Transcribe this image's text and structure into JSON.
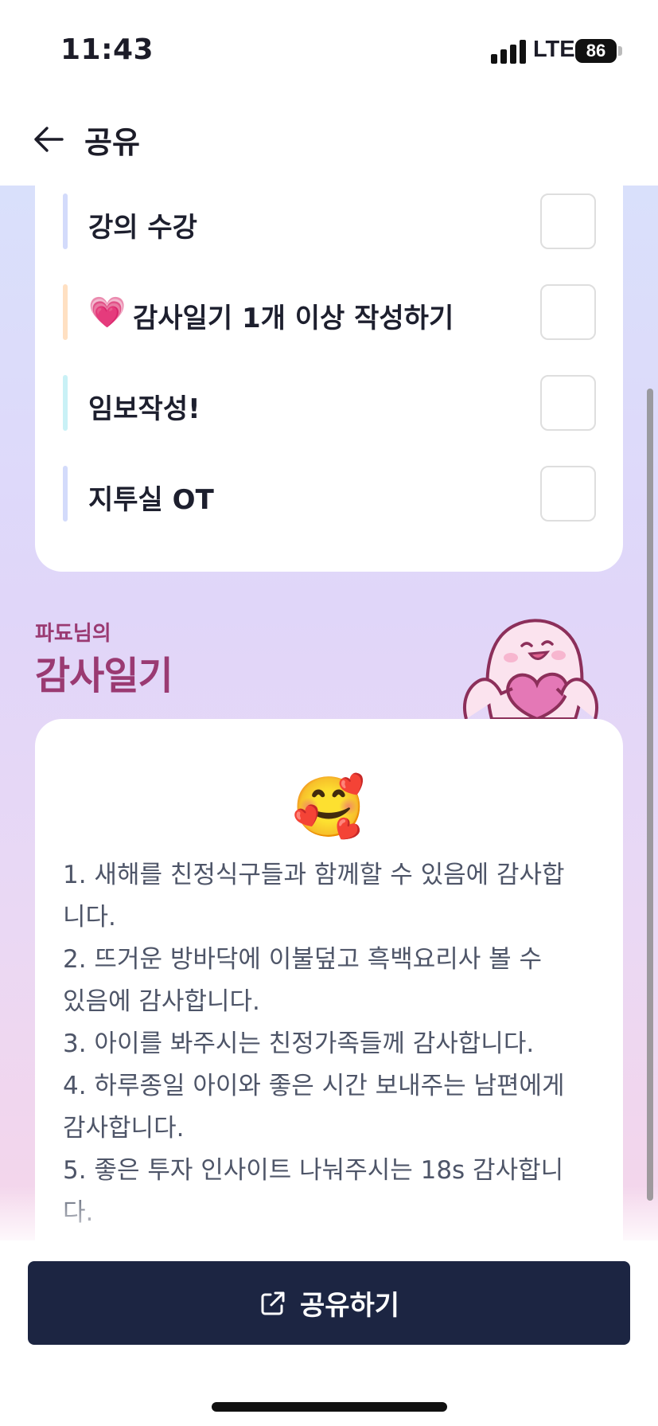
{
  "status": {
    "time": "11:43",
    "network": "LTE",
    "battery": "86"
  },
  "nav": {
    "title": "공유",
    "back_icon": "arrow-left-icon"
  },
  "todos": [
    {
      "label": "강의 수강",
      "emoji": "",
      "bar_color": "#d3dbfb",
      "checked": false
    },
    {
      "label": "감사일기 1개 이상 작성하기",
      "emoji": "💗",
      "bar_color": "#ffe0c2",
      "checked": false
    },
    {
      "label": "임보작성!",
      "emoji": "",
      "bar_color": "#c9f1f6",
      "checked": false
    },
    {
      "label": "지투실 OT",
      "emoji": "",
      "bar_color": "#d3dbfb",
      "checked": false
    }
  ],
  "diary": {
    "owner": "파됴님의",
    "title": "감사일기",
    "emoji": "🥰",
    "lines": [
      "1. 새해를 친정식구들과 함께할 수 있음에 감사합",
      "니다.",
      "2. 뜨거운 방바닥에 이불덮고 흑백요리사 볼 수",
      "있음에 감사합니다.",
      "3. 아이를 봐주시는 친정가족들께 감사합니다.",
      "4. 하루종일 아이와 좋은 시간 보내주는 남편에게",
      "감사합니다.",
      "5. 좋은 투자 인사이트 나눠주시는 18s 감사합니",
      "다."
    ]
  },
  "share_button": {
    "label": "공유하기",
    "icon": "external-link-icon"
  },
  "colors": {
    "accent": "#9a3a72",
    "button": "#1c2542"
  }
}
